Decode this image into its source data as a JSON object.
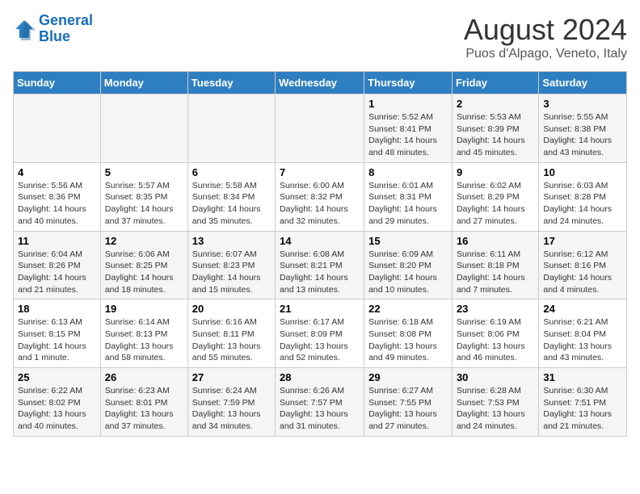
{
  "logo": {
    "line1": "General",
    "line2": "Blue"
  },
  "title": "August 2024",
  "subtitle": "Puos d'Alpago, Veneto, Italy",
  "days_of_week": [
    "Sunday",
    "Monday",
    "Tuesday",
    "Wednesday",
    "Thursday",
    "Friday",
    "Saturday"
  ],
  "weeks": [
    [
      {
        "day": "",
        "info": ""
      },
      {
        "day": "",
        "info": ""
      },
      {
        "day": "",
        "info": ""
      },
      {
        "day": "",
        "info": ""
      },
      {
        "day": "1",
        "info": "Sunrise: 5:52 AM\nSunset: 8:41 PM\nDaylight: 14 hours and 48 minutes."
      },
      {
        "day": "2",
        "info": "Sunrise: 5:53 AM\nSunset: 8:39 PM\nDaylight: 14 hours and 45 minutes."
      },
      {
        "day": "3",
        "info": "Sunrise: 5:55 AM\nSunset: 8:38 PM\nDaylight: 14 hours and 43 minutes."
      }
    ],
    [
      {
        "day": "4",
        "info": "Sunrise: 5:56 AM\nSunset: 8:36 PM\nDaylight: 14 hours and 40 minutes."
      },
      {
        "day": "5",
        "info": "Sunrise: 5:57 AM\nSunset: 8:35 PM\nDaylight: 14 hours and 37 minutes."
      },
      {
        "day": "6",
        "info": "Sunrise: 5:58 AM\nSunset: 8:34 PM\nDaylight: 14 hours and 35 minutes."
      },
      {
        "day": "7",
        "info": "Sunrise: 6:00 AM\nSunset: 8:32 PM\nDaylight: 14 hours and 32 minutes."
      },
      {
        "day": "8",
        "info": "Sunrise: 6:01 AM\nSunset: 8:31 PM\nDaylight: 14 hours and 29 minutes."
      },
      {
        "day": "9",
        "info": "Sunrise: 6:02 AM\nSunset: 8:29 PM\nDaylight: 14 hours and 27 minutes."
      },
      {
        "day": "10",
        "info": "Sunrise: 6:03 AM\nSunset: 8:28 PM\nDaylight: 14 hours and 24 minutes."
      }
    ],
    [
      {
        "day": "11",
        "info": "Sunrise: 6:04 AM\nSunset: 8:26 PM\nDaylight: 14 hours and 21 minutes."
      },
      {
        "day": "12",
        "info": "Sunrise: 6:06 AM\nSunset: 8:25 PM\nDaylight: 14 hours and 18 minutes."
      },
      {
        "day": "13",
        "info": "Sunrise: 6:07 AM\nSunset: 8:23 PM\nDaylight: 14 hours and 15 minutes."
      },
      {
        "day": "14",
        "info": "Sunrise: 6:08 AM\nSunset: 8:21 PM\nDaylight: 14 hours and 13 minutes."
      },
      {
        "day": "15",
        "info": "Sunrise: 6:09 AM\nSunset: 8:20 PM\nDaylight: 14 hours and 10 minutes."
      },
      {
        "day": "16",
        "info": "Sunrise: 6:11 AM\nSunset: 8:18 PM\nDaylight: 14 hours and 7 minutes."
      },
      {
        "day": "17",
        "info": "Sunrise: 6:12 AM\nSunset: 8:16 PM\nDaylight: 14 hours and 4 minutes."
      }
    ],
    [
      {
        "day": "18",
        "info": "Sunrise: 6:13 AM\nSunset: 8:15 PM\nDaylight: 14 hours and 1 minute."
      },
      {
        "day": "19",
        "info": "Sunrise: 6:14 AM\nSunset: 8:13 PM\nDaylight: 13 hours and 58 minutes."
      },
      {
        "day": "20",
        "info": "Sunrise: 6:16 AM\nSunset: 8:11 PM\nDaylight: 13 hours and 55 minutes."
      },
      {
        "day": "21",
        "info": "Sunrise: 6:17 AM\nSunset: 8:09 PM\nDaylight: 13 hours and 52 minutes."
      },
      {
        "day": "22",
        "info": "Sunrise: 6:18 AM\nSunset: 8:08 PM\nDaylight: 13 hours and 49 minutes."
      },
      {
        "day": "23",
        "info": "Sunrise: 6:19 AM\nSunset: 8:06 PM\nDaylight: 13 hours and 46 minutes."
      },
      {
        "day": "24",
        "info": "Sunrise: 6:21 AM\nSunset: 8:04 PM\nDaylight: 13 hours and 43 minutes."
      }
    ],
    [
      {
        "day": "25",
        "info": "Sunrise: 6:22 AM\nSunset: 8:02 PM\nDaylight: 13 hours and 40 minutes."
      },
      {
        "day": "26",
        "info": "Sunrise: 6:23 AM\nSunset: 8:01 PM\nDaylight: 13 hours and 37 minutes."
      },
      {
        "day": "27",
        "info": "Sunrise: 6:24 AM\nSunset: 7:59 PM\nDaylight: 13 hours and 34 minutes."
      },
      {
        "day": "28",
        "info": "Sunrise: 6:26 AM\nSunset: 7:57 PM\nDaylight: 13 hours and 31 minutes."
      },
      {
        "day": "29",
        "info": "Sunrise: 6:27 AM\nSunset: 7:55 PM\nDaylight: 13 hours and 27 minutes."
      },
      {
        "day": "30",
        "info": "Sunrise: 6:28 AM\nSunset: 7:53 PM\nDaylight: 13 hours and 24 minutes."
      },
      {
        "day": "31",
        "info": "Sunrise: 6:30 AM\nSunset: 7:51 PM\nDaylight: 13 hours and 21 minutes."
      }
    ]
  ]
}
